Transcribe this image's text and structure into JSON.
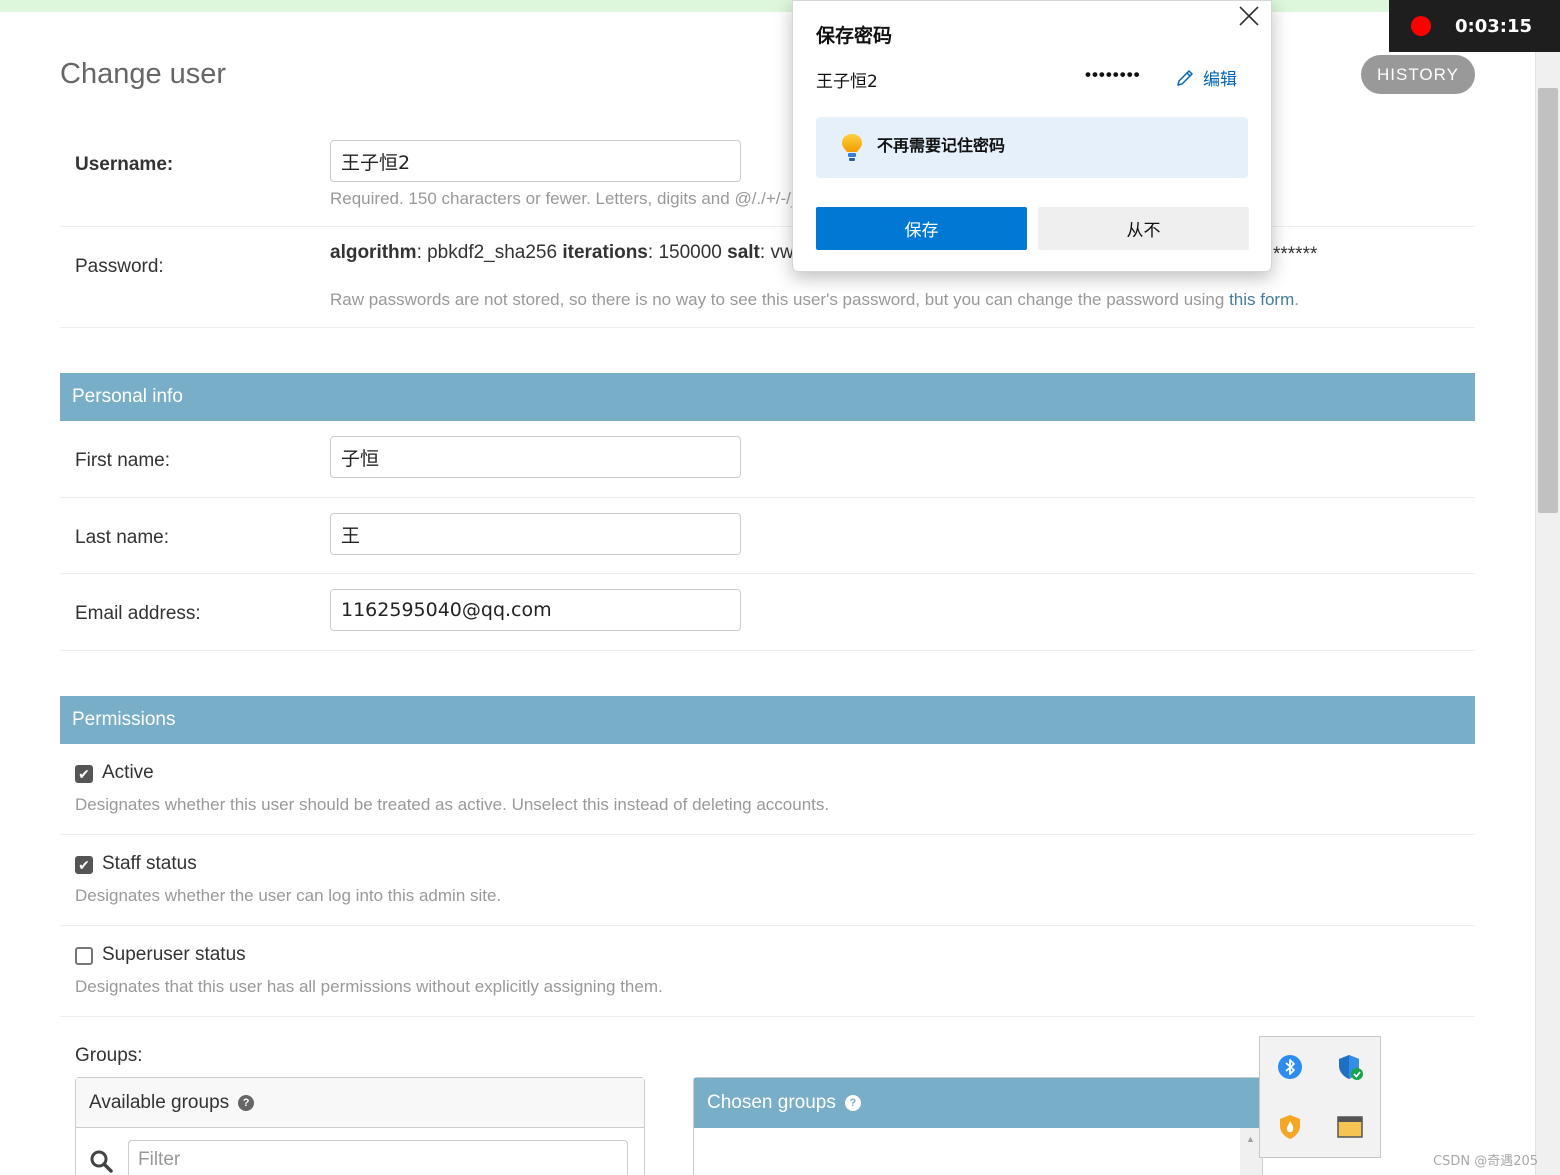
{
  "page": {
    "title": "Change user",
    "history_label": "HISTORY"
  },
  "recording": {
    "time": "0:03:15"
  },
  "username": {
    "label": "Username:",
    "value": "王子恒2",
    "help": "Required. 150 characters or fewer. Letters, digits and @/./+/-/_ only."
  },
  "password": {
    "label": "Password:",
    "algorithm_key": "algorithm",
    "algorithm_val": ": pbkdf2_sha256 ",
    "iterations_key": "iterations",
    "iterations_val": ": 150000 ",
    "salt_key": "salt",
    "salt_val": ": vw",
    "hash_tail": "******",
    "help_prefix": "Raw passwords are not stored, so there is no way to see this user's password, but you can change the password using ",
    "help_link": "this form",
    "help_suffix": "."
  },
  "personal_info": {
    "heading": "Personal info",
    "first_name": {
      "label": "First name:",
      "value": "子恒"
    },
    "last_name": {
      "label": "Last name:",
      "value": "王"
    },
    "email": {
      "label": "Email address:",
      "value": "1162595040@qq.com"
    }
  },
  "permissions": {
    "heading": "Permissions",
    "active": {
      "label": "Active",
      "checked": true,
      "help": "Designates whether this user should be treated as active. Unselect this instead of deleting accounts."
    },
    "staff": {
      "label": "Staff status",
      "checked": true,
      "help": "Designates whether the user can log into this admin site."
    },
    "superuser": {
      "label": "Superuser status",
      "checked": false,
      "help": "Designates that this user has all permissions without explicitly assigning them."
    },
    "groups_label": "Groups:",
    "available_groups": {
      "title": "Available groups",
      "help_icon": "question-circle-icon",
      "filter_placeholder": "Filter",
      "search_icon": "search-icon"
    },
    "chosen_groups": {
      "title": "Chosen groups",
      "help_icon": "question-circle-icon"
    }
  },
  "password_popup": {
    "title": "保存密码",
    "username": "王子恒2",
    "masked_password": "••••••••",
    "edit_label": "编辑",
    "tip": "不再需要记住密码",
    "save_label": "保存",
    "never_label": "从不",
    "close_icon": "close-icon",
    "edit_icon": "pencil-icon",
    "tip_icon": "lightbulb-icon"
  },
  "tray": {
    "icons": [
      "bluetooth-icon",
      "security-shield-icon",
      "firewall-icon",
      "window-app-icon"
    ]
  },
  "watermark": "CSDN @奇遇205",
  "colors": {
    "module_header": "#79aec8",
    "link": "#447e9b",
    "edge_primary": "#0078d4",
    "record_dot": "#ff0000"
  }
}
